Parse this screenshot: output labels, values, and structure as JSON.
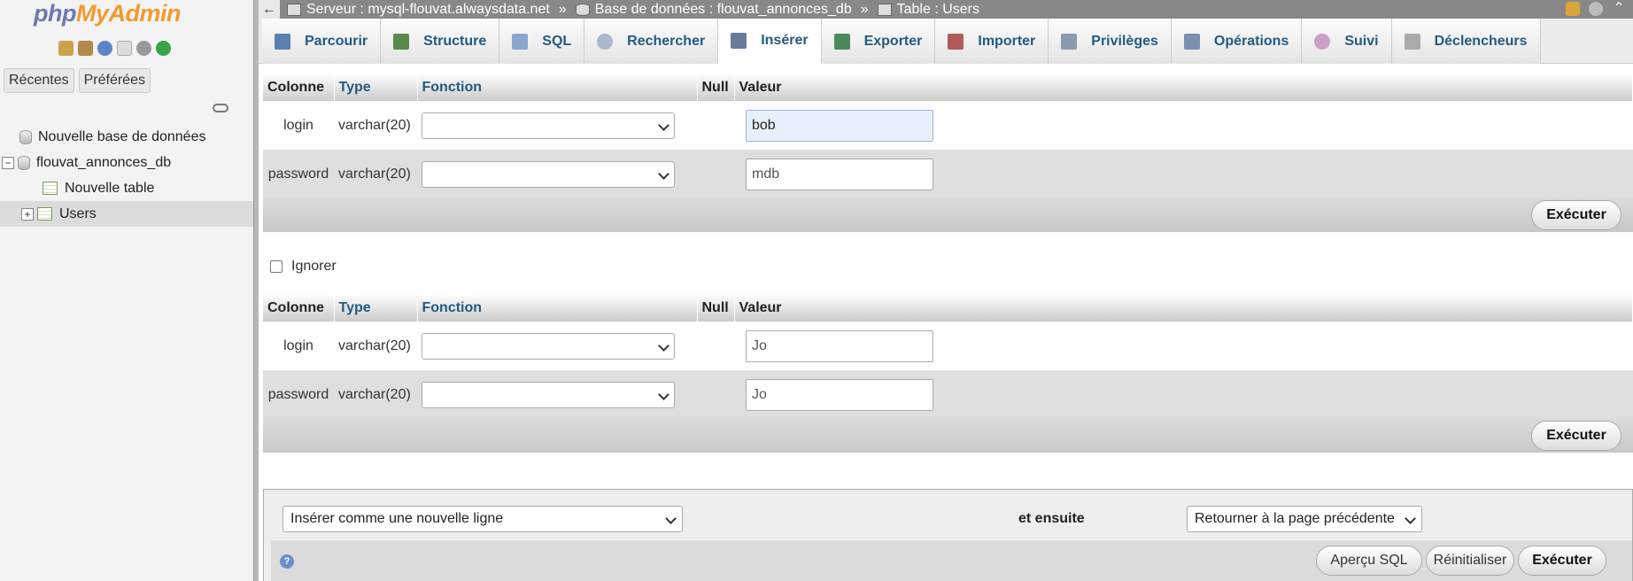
{
  "app": {
    "logo_php": "php",
    "logo_myadmin": "MyAdmin"
  },
  "sidebar": {
    "tabs": [
      "Récentes",
      "Préférées"
    ],
    "tree": {
      "new_db": "Nouvelle base de données",
      "db_name": "flouvat_annonces_db",
      "new_table": "Nouvelle table",
      "table_users": "Users"
    }
  },
  "breadcrumb": {
    "server": "Serveur : mysql-flouvat.alwaysdata.net",
    "database": "Base de données : flouvat_annonces_db",
    "table": "Table : Users",
    "separator": "»"
  },
  "tabs": [
    {
      "label": "Parcourir",
      "icon": "browse-icon"
    },
    {
      "label": "Structure",
      "icon": "structure-icon"
    },
    {
      "label": "SQL",
      "icon": "sql-icon"
    },
    {
      "label": "Rechercher",
      "icon": "search-icon"
    },
    {
      "label": "Insérer",
      "icon": "insert-icon",
      "active": true
    },
    {
      "label": "Exporter",
      "icon": "export-icon"
    },
    {
      "label": "Importer",
      "icon": "import-icon"
    },
    {
      "label": "Privilèges",
      "icon": "privileges-icon"
    },
    {
      "label": "Opérations",
      "icon": "wrench-icon"
    },
    {
      "label": "Suivi",
      "icon": "eye-icon"
    },
    {
      "label": "Déclencheurs",
      "icon": "triggers-icon"
    }
  ],
  "table_headers": {
    "colonne": "Colonne",
    "type": "Type",
    "fonction": "Fonction",
    "null": "Null",
    "valeur": "Valeur"
  },
  "insert_form_1": {
    "rows": [
      {
        "column": "login",
        "type": "varchar(20)",
        "value": "bob"
      },
      {
        "column": "password",
        "type": "varchar(20)",
        "value": "mdb"
      }
    ],
    "execute_label": "Exécuter"
  },
  "ignore_label": "Ignorer",
  "insert_form_2": {
    "rows": [
      {
        "column": "login",
        "type": "varchar(20)",
        "value": "Jo"
      },
      {
        "column": "password",
        "type": "varchar(20)",
        "value": "Jo"
      }
    ],
    "execute_label": "Exécuter"
  },
  "bottom": {
    "insert_mode": "Insérer comme une nouvelle ligne",
    "et_ensuite": "et ensuite",
    "after_action": "Retourner à la page précédente",
    "preview_sql": "Aperçu SQL",
    "reset": "Réinitialiser",
    "execute": "Exécuter",
    "help": "?"
  },
  "colors": {
    "link_blue": "#235a81",
    "topbar_gray": "#888888",
    "logo_purple": "#6c78af",
    "logo_orange": "#f29a30"
  }
}
